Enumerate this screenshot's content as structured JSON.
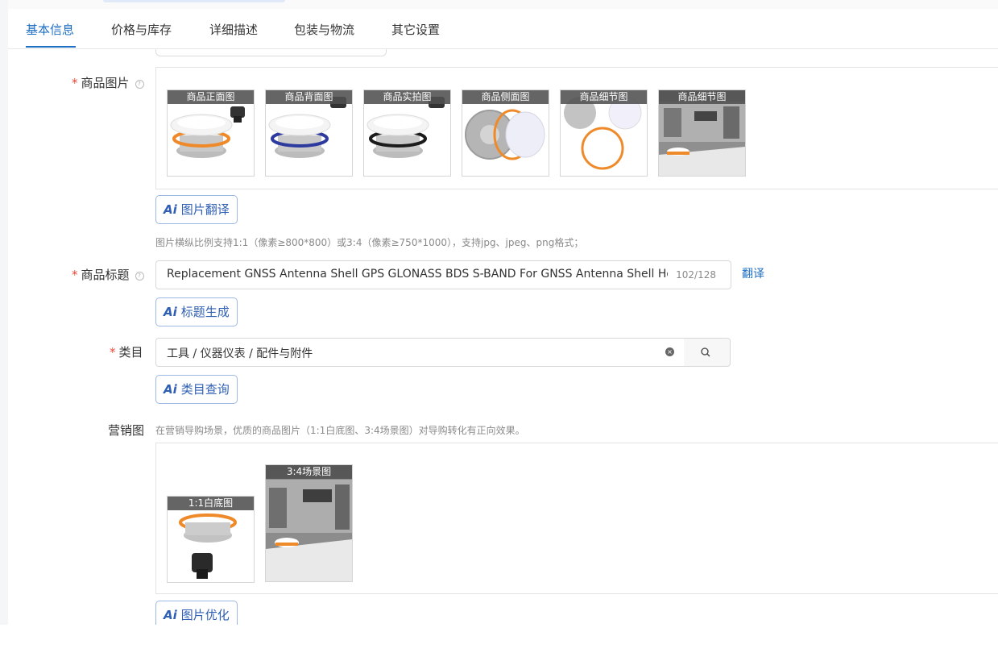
{
  "tabs": [
    {
      "label": "基本信息",
      "active": true
    },
    {
      "label": "价格与库存",
      "active": false
    },
    {
      "label": "详细描述",
      "active": false
    },
    {
      "label": "包装与物流",
      "active": false
    },
    {
      "label": "其它设置",
      "active": false
    }
  ],
  "product_images": {
    "required_mark": "*",
    "label": "商品图片",
    "help_glyph": "?",
    "thumbnails": [
      {
        "caption": "商品正面图"
      },
      {
        "caption": "商品背面图"
      },
      {
        "caption": "商品实拍图"
      },
      {
        "caption": "商品侧面图"
      },
      {
        "caption": "商品细节图"
      },
      {
        "caption": "商品细节图"
      }
    ],
    "ai_icon": "Ai",
    "ai_button": "图片翻译",
    "hint": "图片横纵比例支持1:1（像素≥800*800）或3:4（像素≥750*1000），支持jpg、jpeg、png格式；"
  },
  "product_title": {
    "required_mark": "*",
    "label": "商品标题",
    "help_glyph": "?",
    "value": "Replacement GNSS Antenna Shell GPS GLONASS BDS S-BAND For GNSS Antenna Shell Hou",
    "count": "102/128",
    "translate_link": "翻译",
    "ai_icon": "Ai",
    "ai_button": "标题生成"
  },
  "category": {
    "required_mark": "*",
    "label": "类目",
    "value": "工具 / 仪器仪表 / 配件与附件",
    "clear_glyph": "×",
    "ai_icon": "Ai",
    "ai_button": "类目查询"
  },
  "marketing_images": {
    "label": "营销图",
    "hint": "在营销导购场景，优质的商品图片（1:1白底图、3:4场景图）对导购转化有正向效果。",
    "thumbnails": [
      {
        "caption": "1:1白底图"
      },
      {
        "caption": "3:4场景图"
      }
    ],
    "ai_icon": "Ai",
    "ai_button": "图片优化"
  },
  "colors": {
    "accent": "#1f6fc5",
    "required": "#e8493a",
    "ai_text": "#2f5fb3",
    "ai_border": "#9db8e2",
    "orange_ring": "#ee8a2a",
    "blue_ring": "#2d3a9e",
    "black_ring": "#1c1c1c"
  },
  "icons": {
    "help": "question-circle-icon",
    "clear": "close-circle-icon",
    "search": "magnifier-icon",
    "ai": "ai-sparkle-icon"
  }
}
